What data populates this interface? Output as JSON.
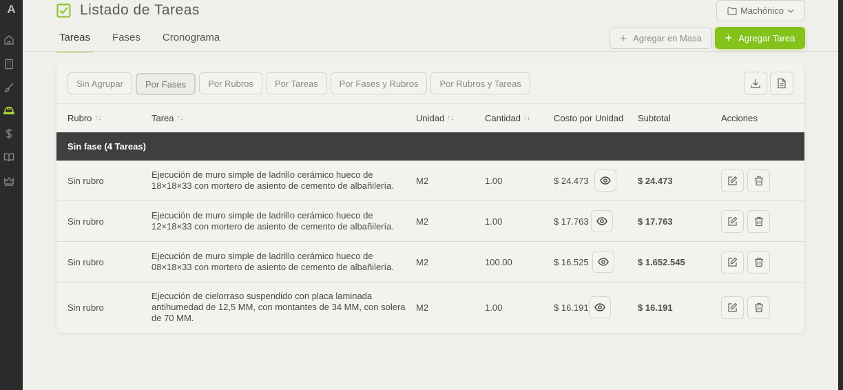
{
  "app": {
    "logo": "A"
  },
  "header": {
    "title": "Listado de Tareas",
    "project": "Machónico",
    "tabs": [
      {
        "label": "Tareas",
        "active": true
      },
      {
        "label": "Fases",
        "active": false
      },
      {
        "label": "Cronograma",
        "active": false
      }
    ],
    "mass_button": "Agregar en Masa",
    "add_button": "Agregar Tarea"
  },
  "sidebar": {
    "icons": [
      "home-icon",
      "building-icon",
      "brush-icon",
      "helmet-icon",
      "dollar-icon",
      "book-icon",
      "crown-icon"
    ],
    "active": "helmet-icon"
  },
  "grouping": {
    "options": [
      {
        "label": "Sin Agrupar",
        "active": false
      },
      {
        "label": "Por Fases",
        "active": true
      },
      {
        "label": "Por Rubros",
        "active": false
      },
      {
        "label": "Por Tareas",
        "active": false
      },
      {
        "label": "Por Fases y Rubros",
        "active": false
      },
      {
        "label": "Por Rubros y Tareas",
        "active": false
      }
    ]
  },
  "table": {
    "columns": [
      "Rubro",
      "Tarea",
      "Unidad",
      "Cantidad",
      "Costo por Unidad",
      "Subtotal",
      "Acciones"
    ],
    "group_label": "Sin fase (4 Tareas)",
    "rows": [
      {
        "rubro": "Sin rubro",
        "tarea": "Ejecución de muro simple de ladrillo cerámico hueco de 18×18×33 con mortero de asiento de cemento de albañilería.",
        "unidad": "M2",
        "cantidad": "1.00",
        "costo": "$ 24.473",
        "subtotal": "$ 24.473"
      },
      {
        "rubro": "Sin rubro",
        "tarea": "Ejecución de muro simple de ladrillo cerámico hueco de 12×18×33 con mortero de asiento de cemento de albañilería.",
        "unidad": "M2",
        "cantidad": "1.00",
        "costo": "$ 17.763",
        "subtotal": "$ 17.763"
      },
      {
        "rubro": "Sin rubro",
        "tarea": "Ejecución de muro simple de ladrillo cerámico hueco de 08×18×33 con mortero de asiento de cemento de albañilería.",
        "unidad": "M2",
        "cantidad": "100.00",
        "costo": "$ 16.525",
        "subtotal": "$ 1.652.545"
      },
      {
        "rubro": "Sin rubro",
        "tarea": "Ejecución de cielorraso suspendido con placa laminada antihumedad de 12,5 MM, con montantes de 34 MM, con solera de 70 MM.",
        "unidad": "M2",
        "cantidad": "1.00",
        "costo": "$ 16.191",
        "subtotal": "$ 16.191"
      }
    ]
  },
  "colors": {
    "accent": "#84c21c",
    "group_header": "#3f3f3f",
    "rail": "#2b2b2b"
  }
}
